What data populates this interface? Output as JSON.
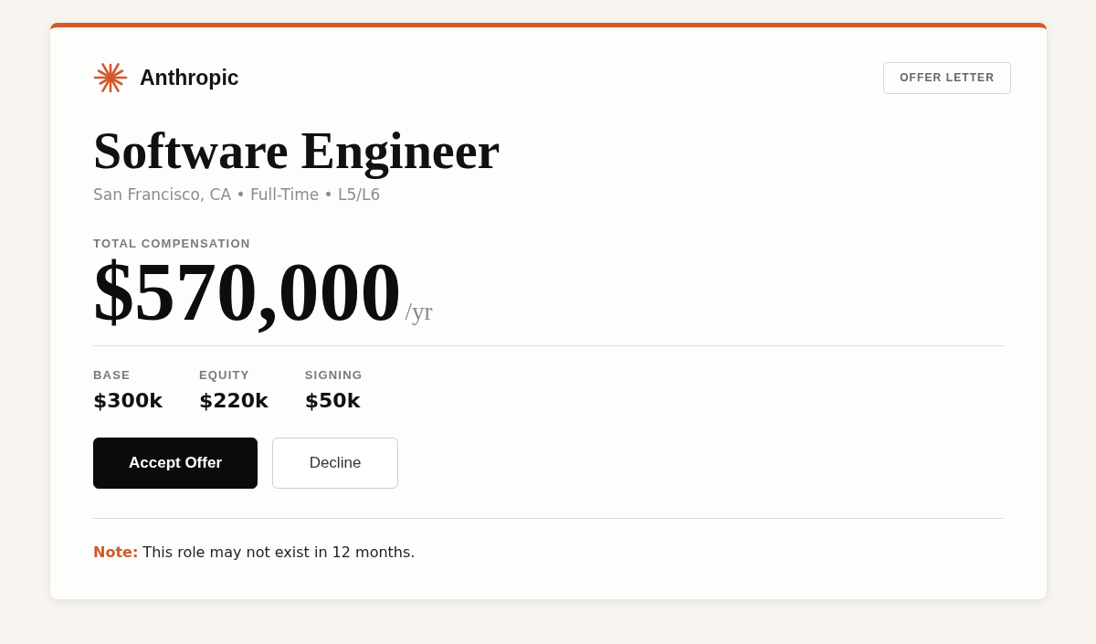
{
  "header": {
    "brand": "Anthropic",
    "badge": "OFFER LETTER"
  },
  "title": "Software Engineer",
  "subtitle": "San Francisco, CA • Full-Time • L5/L6",
  "compensation": {
    "label": "TOTAL COMPENSATION",
    "amount": "$570,000",
    "period": "/yr"
  },
  "breakdown": [
    {
      "label": "BASE",
      "value": "$300k"
    },
    {
      "label": "EQUITY",
      "value": "$220k"
    },
    {
      "label": "SIGNING",
      "value": "$50k"
    }
  ],
  "buttons": [
    {
      "label": "Accept Offer",
      "kind": "primary"
    },
    {
      "label": "Decline",
      "kind": "secondary"
    }
  ],
  "note": "**Note:** This role may not exist in 12 months."
}
